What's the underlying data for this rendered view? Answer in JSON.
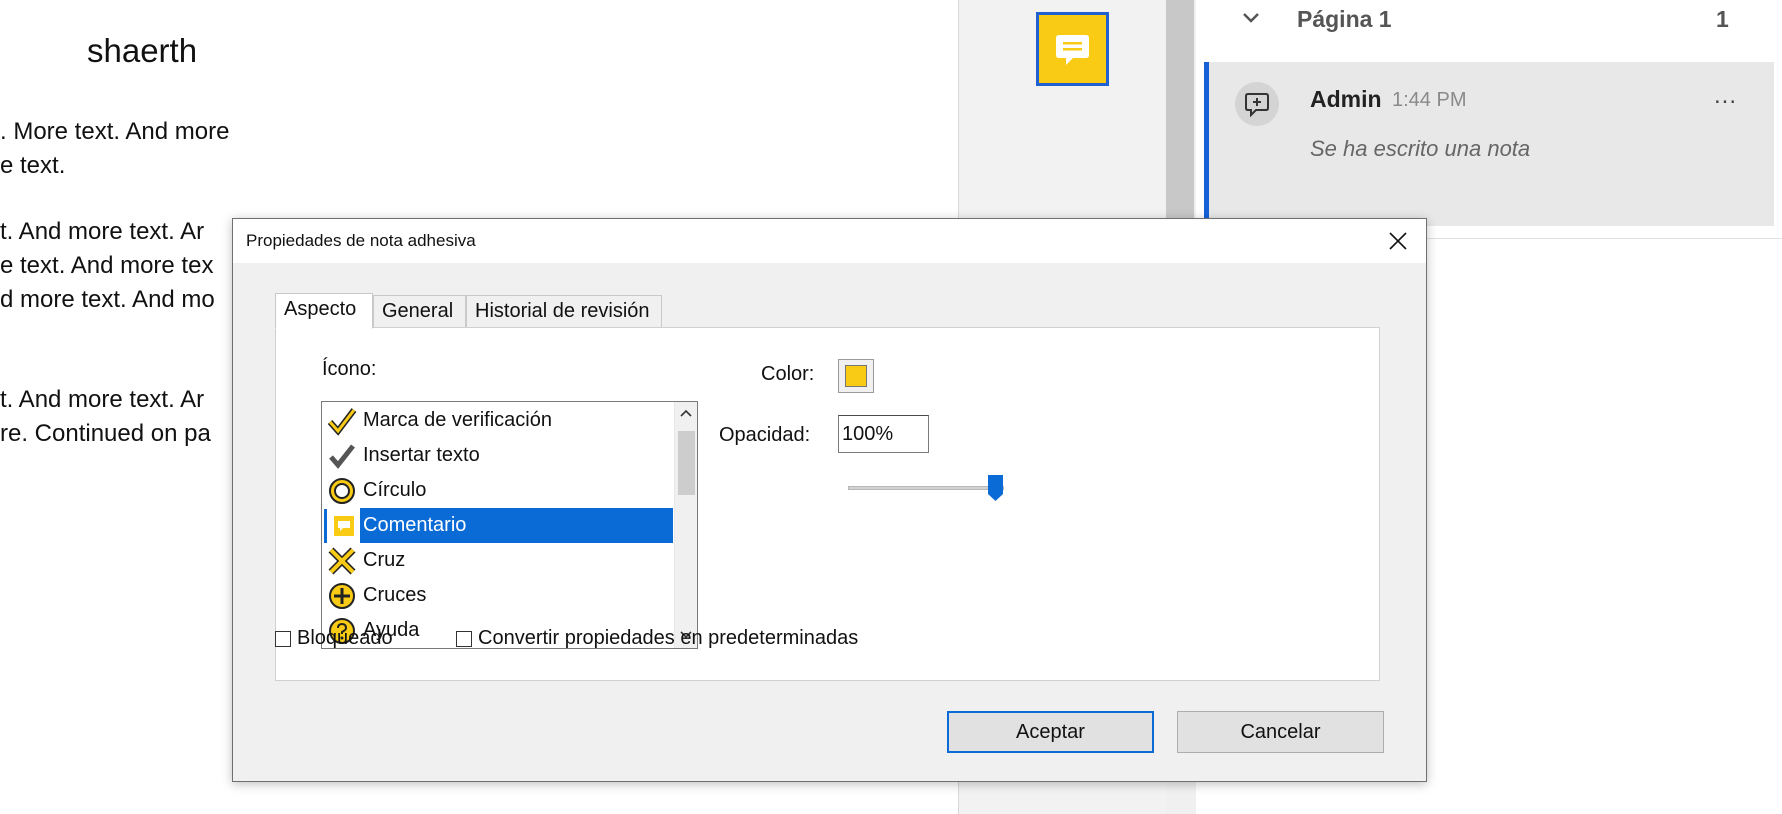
{
  "document": {
    "title": "shaerth",
    "lines": [
      ". More text. And more",
      "e text.",
      "t. And more text. Ar",
      "e text. And more tex",
      "d more text. And mo",
      "t. And more text. Ar",
      "re. Continued on pa"
    ]
  },
  "comments_panel": {
    "page_label": "Página 1",
    "page_count": "1",
    "comment": {
      "author": "Admin",
      "time": "1:44 PM",
      "text": "Se ha escrito una nota",
      "more": "..."
    }
  },
  "dialog": {
    "title": "Propiedades de nota adhesiva",
    "tabs": [
      "Aspecto",
      "General",
      "Historial de revisión"
    ],
    "active_tab": "Aspecto",
    "icon_label": "Ícono:",
    "icon_list": [
      {
        "label": "Marca de verificación",
        "icon": "checkmark-icon"
      },
      {
        "label": "Insertar texto",
        "icon": "insert-text-icon"
      },
      {
        "label": "Círculo",
        "icon": "circle-icon"
      },
      {
        "label": "Comentario",
        "icon": "comment-icon",
        "selected": true
      },
      {
        "label": "Cruz",
        "icon": "cross-icon"
      },
      {
        "label": "Cruces",
        "icon": "crosshairs-icon"
      },
      {
        "label": "Ayuda",
        "icon": "help-icon"
      }
    ],
    "color_label": "Color:",
    "color_value": "#f9cb14",
    "opacity_label": "Opacidad:",
    "opacity_value": "100%",
    "opacity_slider": 1.0,
    "locked_label": "Bloqueado",
    "locked_checked": false,
    "defaults_label": "Convertir propiedades en predeterminadas",
    "defaults_checked": false,
    "ok_label": "Aceptar",
    "cancel_label": "Cancelar"
  },
  "colors": {
    "accent": "#0a6ad6",
    "note_yellow": "#f9cb14"
  }
}
